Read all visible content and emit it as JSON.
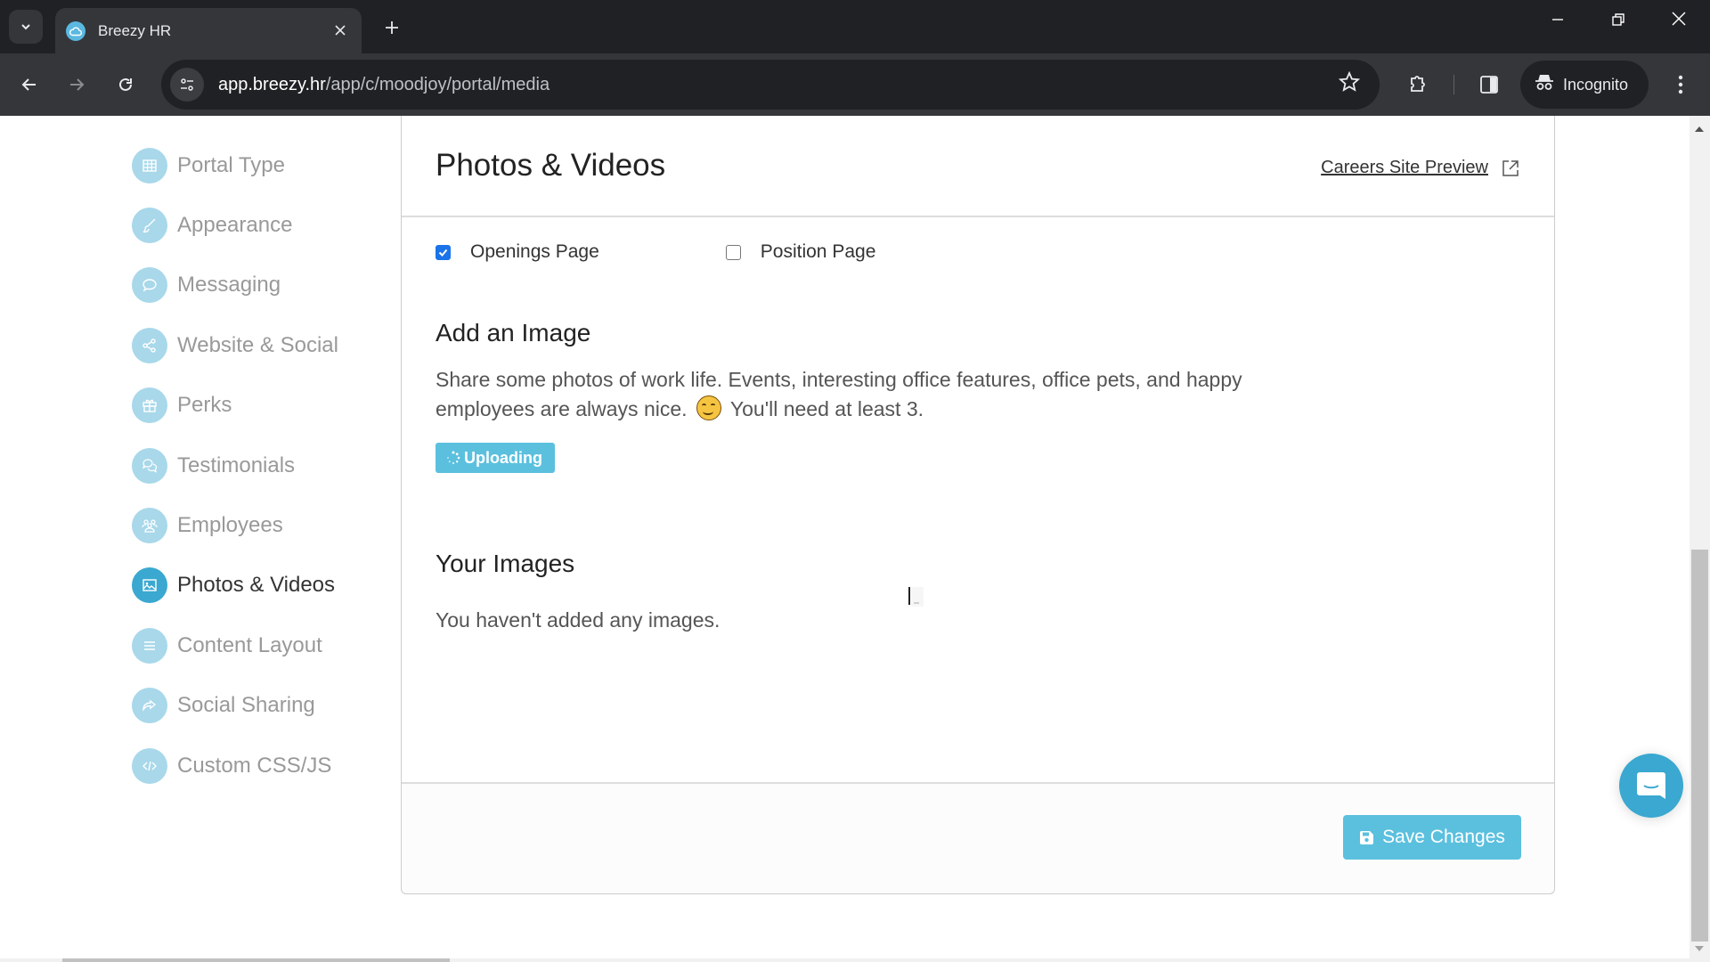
{
  "browser": {
    "tab": {
      "title": "Breezy HR",
      "favicon": "breezy-cloud-icon"
    },
    "url": {
      "host": "app.breezy.hr",
      "path": "/app/c/moodjoy/portal/media"
    },
    "profile_label": "Incognito",
    "icons": {
      "tab_list": "chevron-down-icon",
      "tab_close": "close-icon",
      "new_tab": "plus-icon",
      "minimize": "minimize-icon",
      "restore": "restore-icon",
      "close_window": "close-icon",
      "back": "arrow-left-icon",
      "forward": "arrow-right-icon",
      "reload": "reload-icon",
      "site_info": "tune-icon",
      "bookmark": "star-icon",
      "extensions": "puzzle-icon",
      "side_panel": "side-panel-icon",
      "incognito": "incognito-icon",
      "menu": "kebab-menu-icon"
    }
  },
  "sidebar": {
    "items": [
      {
        "label": "Portal Type",
        "icon": "grid-icon",
        "active": false
      },
      {
        "label": "Appearance",
        "icon": "brush-icon",
        "active": false
      },
      {
        "label": "Messaging",
        "icon": "chat-bubble-icon",
        "active": false
      },
      {
        "label": "Website & Social",
        "icon": "share-icon",
        "active": false
      },
      {
        "label": "Perks",
        "icon": "gift-icon",
        "active": false
      },
      {
        "label": "Testimonials",
        "icon": "comments-icon",
        "active": false
      },
      {
        "label": "Employees",
        "icon": "users-icon",
        "active": false
      },
      {
        "label": "Photos & Videos",
        "icon": "image-icon",
        "active": true
      },
      {
        "label": "Content Layout",
        "icon": "list-icon",
        "active": false
      },
      {
        "label": "Social Sharing",
        "icon": "forward-share-icon",
        "active": false
      },
      {
        "label": "Custom CSS/JS",
        "icon": "code-icon",
        "active": false
      }
    ]
  },
  "main": {
    "title": "Photos & Videos",
    "preview_link": "Careers Site Preview",
    "checkboxes": [
      {
        "label": "Openings Page",
        "checked": true
      },
      {
        "label": "Position Page",
        "checked": false
      }
    ],
    "add_image": {
      "title": "Add an Image",
      "description_part1": "Share some photos of work life. Events, interesting office features, office pets, and happy employees are always nice.",
      "description_part2": "You'll need at least 3.",
      "upload_button": "Uploading"
    },
    "your_images": {
      "title": "Your Images",
      "empty_message": "You haven't added any images."
    },
    "save_button": "Save Changes"
  },
  "colors": {
    "accent": "#5bc0de",
    "active_icon": "#3aa8d0",
    "inactive_icon": "#a8d8ea",
    "checkbox_checked": "#1a73e8"
  }
}
